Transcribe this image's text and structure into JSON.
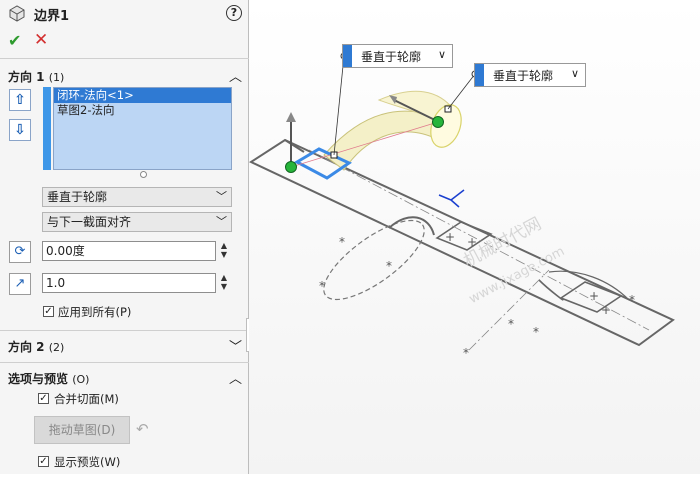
{
  "panel": {
    "title": "边界1",
    "help": "?",
    "ok": "✔",
    "cancel": "✕",
    "direction1": {
      "heading": "方向 1",
      "count": "(1)",
      "items": [
        "闭环-法向<1>",
        "草图2-法向"
      ],
      "up": "⇧",
      "down": "⇩",
      "tangent_type": "垂直于轮廓",
      "alignment": "与下一截面对齐",
      "draft_angle": "0.00度",
      "tangent_length": "1.0",
      "apply_all": "应用到所有(P)",
      "apply_all_checked": true
    },
    "direction2": {
      "heading": "方向 2",
      "count": "(2)"
    },
    "options": {
      "heading": "选项与预览",
      "count": "(O)",
      "merge_faces": "合并切面(M)",
      "merge_checked": true,
      "drag_sketch": "拖动草图(D)",
      "show_preview": "显示预览(W)",
      "preview_checked": true
    },
    "chevron_up": "︿",
    "chevron_down": "﹀"
  },
  "viewport": {
    "callout1": "垂直于轮廓",
    "callout2": "垂直于轮廓",
    "callout_dd": "∨",
    "watermark1": "机械时代网",
    "watermark2": "www.jixage.com"
  }
}
